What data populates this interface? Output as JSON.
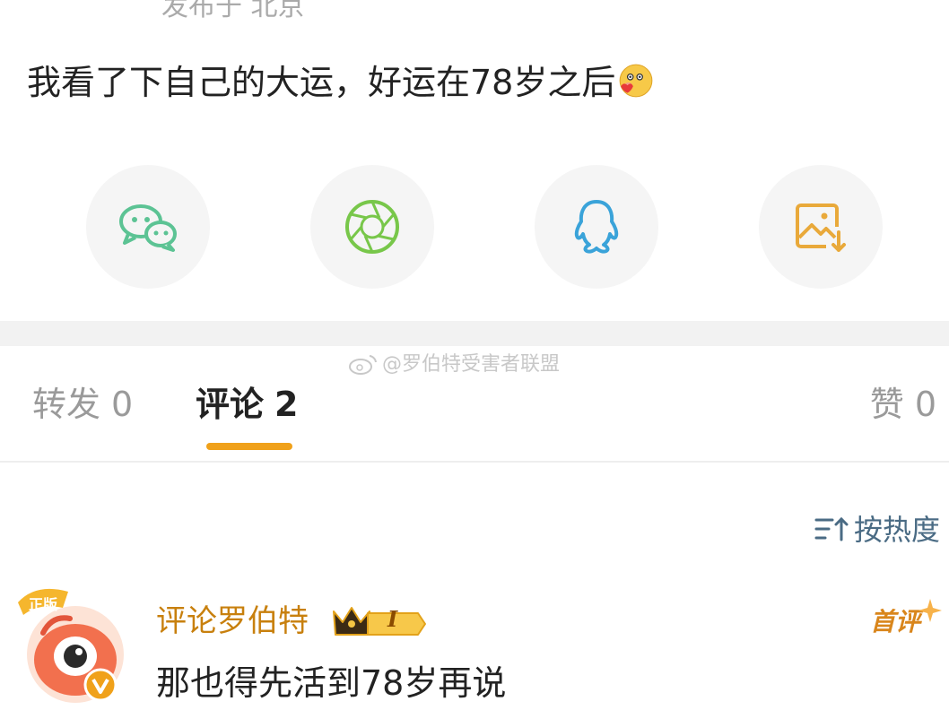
{
  "post": {
    "location": "发布于 北京",
    "text": "我看了下自己的大运，好运在78岁之后"
  },
  "share": {
    "items": [
      "wechat-icon",
      "moments-icon",
      "qq-icon",
      "save-image-icon"
    ],
    "colors": {
      "wechat": "#5cc394",
      "moments": "#78c74a",
      "qq": "#3aa3d9",
      "save": "#e9a93a"
    }
  },
  "watermark": "@罗伯特受害者联盟",
  "tabs": {
    "repost": {
      "label": "转发",
      "count": "0"
    },
    "comments": {
      "label": "评论",
      "count": "2"
    },
    "likes": {
      "label": "赞",
      "count": "0"
    }
  },
  "sort": {
    "label": "按热度"
  },
  "comment": {
    "user": "评论罗伯特",
    "level_badge": "I",
    "tag": "首评",
    "text": "那也得先活到78岁再说"
  },
  "colors": {
    "accent": "#f0a11a",
    "username": "#c8800e",
    "sort": "#4a6b84"
  }
}
